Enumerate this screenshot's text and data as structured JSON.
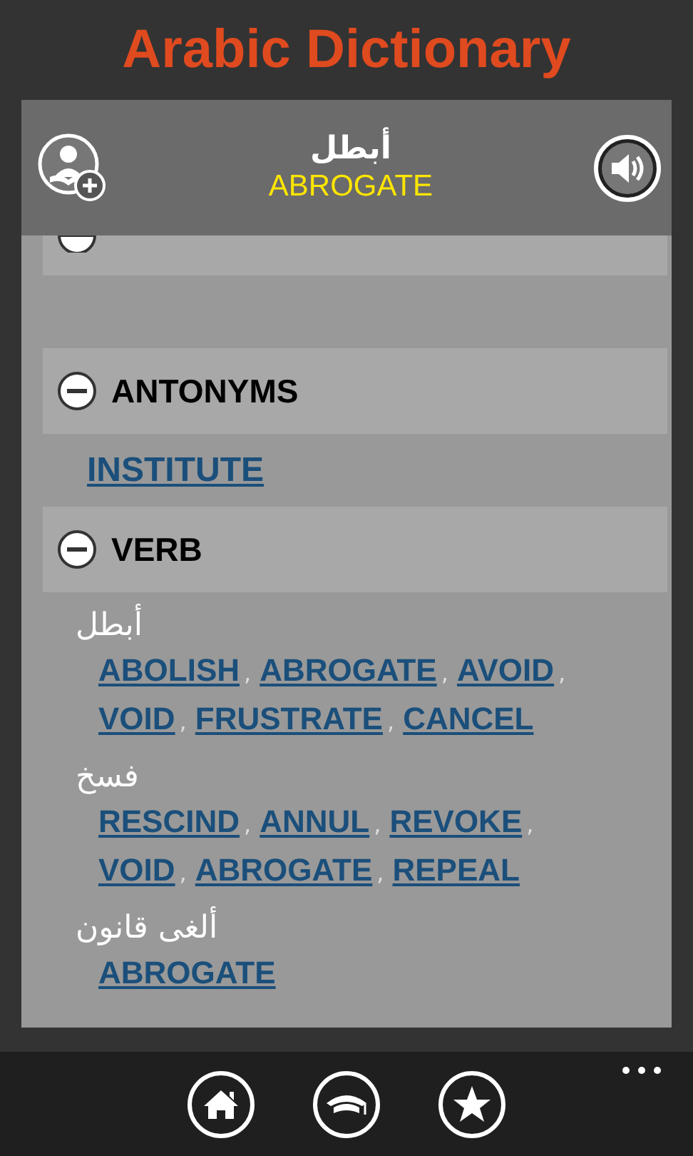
{
  "app_title": "Arabic Dictionary",
  "word": {
    "arabic": "أبطل",
    "english": "ABROGATE"
  },
  "sections": [
    {
      "kind": "cut_off"
    },
    {
      "kind": "links",
      "title": "ANTONYMS",
      "expanded": true,
      "links": [
        "INSTITUTE"
      ]
    },
    {
      "kind": "groups",
      "title": "VERB",
      "expanded": true,
      "separator": ",",
      "groups": [
        {
          "arabic": "أبطل",
          "links": [
            "ABOLISH",
            "ABROGATE",
            "AVOID",
            "VOID",
            "FRUSTRATE",
            "CANCEL"
          ]
        },
        {
          "arabic": "فسخ",
          "links": [
            "RESCIND",
            "ANNUL",
            "REVOKE",
            "VOID",
            "ABROGATE",
            "REPEAL"
          ]
        },
        {
          "arabic": "ألغى قانون",
          "links": [
            "ABROGATE"
          ]
        }
      ]
    }
  ],
  "app_bar": {
    "buttons": [
      {
        "kind": "home"
      },
      {
        "kind": "education"
      },
      {
        "kind": "favorites"
      }
    ]
  }
}
